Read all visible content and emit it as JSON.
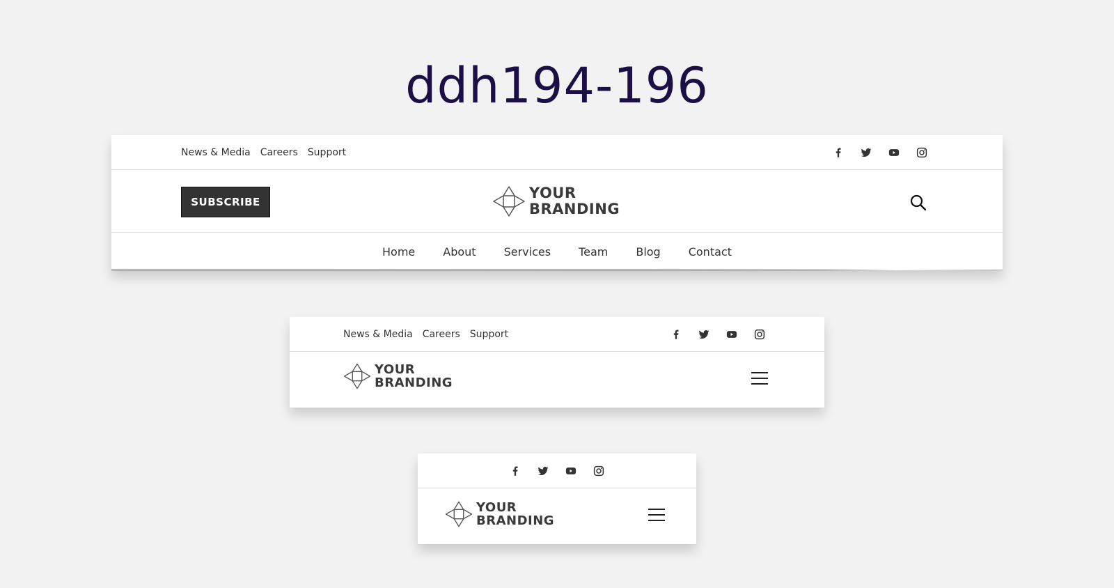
{
  "page": {
    "title": "ddh194-196"
  },
  "brand": {
    "line1": "YOUR",
    "line2": "BRANDING"
  },
  "topbar_links": [
    "News & Media",
    "Careers",
    "Support"
  ],
  "socials": [
    "facebook-icon",
    "twitter-icon",
    "youtube-icon",
    "instagram-icon"
  ],
  "header_desktop": {
    "subscribe_label": "SUBSCRIBE",
    "nav": [
      "Home",
      "About",
      "Services",
      "Team",
      "Blog",
      "Contact"
    ]
  },
  "colors": {
    "title": "#1b0f45",
    "button_bg": "#333333",
    "text": "#333333"
  }
}
